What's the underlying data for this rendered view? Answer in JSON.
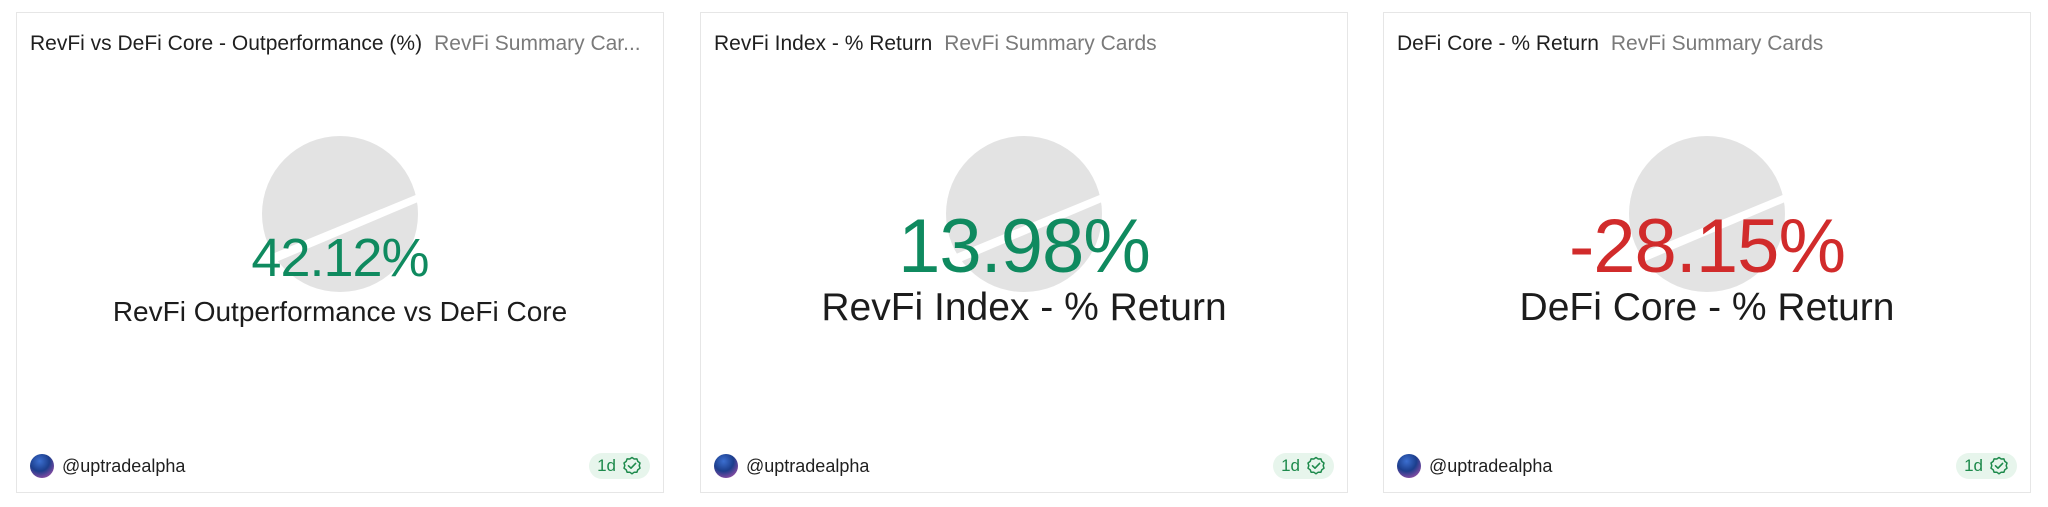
{
  "cards": [
    {
      "title": "RevFi vs DeFi Core - Outperformance (%)",
      "subtitle": "RevFi Summary Car...",
      "value": "42.12%",
      "label": "RevFi Outperformance vs DeFi Core",
      "value_color": "#0f8a5f",
      "author": "@uptradealpha",
      "freshness": "1d"
    },
    {
      "title": "RevFi Index - % Return",
      "subtitle": "RevFi Summary Cards",
      "value": "13.98%",
      "label": "RevFi Index - % Return",
      "value_color": "#0f8a5f",
      "author": "@uptradealpha",
      "freshness": "1d"
    },
    {
      "title": "DeFi Core - % Return",
      "subtitle": "RevFi Summary Cards",
      "value": "-28.15%",
      "label": "DeFi Core - % Return",
      "value_color": "#d12b2b",
      "author": "@uptradealpha",
      "freshness": "1d"
    }
  ],
  "icons": {
    "watermark": "watermark-logo-icon",
    "avatar": "avatar-icon",
    "freshness": "check-badge-icon"
  },
  "colors": {
    "positive": "#0f8a5f",
    "negative": "#d12b2b",
    "badge_bg": "#e7f5ec",
    "watermark": "#e3e3e3"
  }
}
